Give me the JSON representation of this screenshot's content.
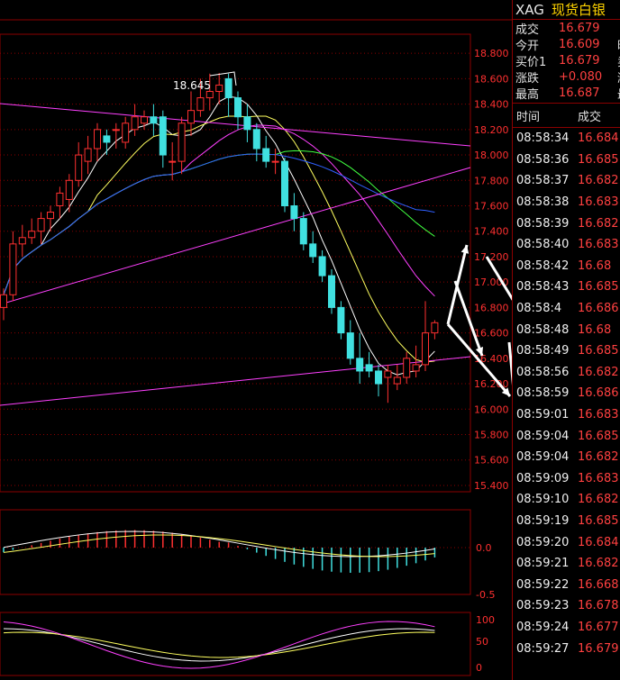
{
  "symbol": "XAG",
  "name": "现货白银",
  "quote": [
    {
      "label": "成交",
      "value": "16.679",
      "extra": ""
    },
    {
      "label": "今开",
      "value": "16.609",
      "extra": "昨"
    },
    {
      "label": "买价1",
      "value": "16.679",
      "extra": "卖"
    },
    {
      "label": "涨跌",
      "value": "+0.080",
      "extra": "涨"
    },
    {
      "label": "最高",
      "value": "16.687",
      "extra": "最"
    }
  ],
  "ticks_header": {
    "time": "时间",
    "price": "成交"
  },
  "ticks": [
    {
      "time": "08:58:34",
      "price": "16.684"
    },
    {
      "time": "08:58:36",
      "price": "16.685"
    },
    {
      "time": "08:58:37",
      "price": "16.682"
    },
    {
      "time": "08:58:38",
      "price": "16.683"
    },
    {
      "time": "08:58:39",
      "price": "16.682"
    },
    {
      "time": "08:58:40",
      "price": "16.683"
    },
    {
      "time": "08:58:42",
      "price": "16.68"
    },
    {
      "time": "08:58:43",
      "price": "16.685"
    },
    {
      "time": "08:58:4",
      "price": "16.686"
    },
    {
      "time": "08:58:48",
      "price": "16.68"
    },
    {
      "time": "08:58:49",
      "price": "16.685"
    },
    {
      "time": "08:58:56",
      "price": "16.682"
    },
    {
      "time": "08:58:59",
      "price": "16.686"
    },
    {
      "time": "08:59:01",
      "price": "16.683"
    },
    {
      "time": "08:59:04",
      "price": "16.685"
    },
    {
      "time": "08:59:04",
      "price": "16.682"
    },
    {
      "time": "08:59:09",
      "price": "16.683"
    },
    {
      "time": "08:59:10",
      "price": "16.682"
    },
    {
      "time": "08:59:19",
      "price": "16.685"
    },
    {
      "time": "08:59:20",
      "price": "16.684"
    },
    {
      "time": "08:59:21",
      "price": "16.682"
    },
    {
      "time": "08:59:22",
      "price": "16.668"
    },
    {
      "time": "08:59:23",
      "price": "16.678"
    },
    {
      "time": "08:59:24",
      "price": "16.677"
    },
    {
      "time": "08:59:27",
      "price": "16.679"
    }
  ],
  "chart_data": {
    "type": "candlestick",
    "price_axis": {
      "labels": [
        "18.800",
        "18.600",
        "18.400",
        "18.200",
        "18.000",
        "17.800",
        "17.600",
        "17.400",
        "17.200",
        "17.000",
        "16.800",
        "16.600",
        "16.400",
        "16.200",
        "16.000",
        "15.800",
        "15.600",
        "15.400"
      ],
      "range": [
        15.35,
        18.95
      ]
    },
    "high_annotation": "18.645",
    "candles": [
      [
        16.8,
        16.9,
        16.7,
        16.95
      ],
      [
        16.9,
        17.3,
        16.85,
        17.4
      ],
      [
        17.3,
        17.35,
        17.2,
        17.45
      ],
      [
        17.35,
        17.4,
        17.3,
        17.5
      ],
      [
        17.4,
        17.5,
        17.3,
        17.55
      ],
      [
        17.5,
        17.55,
        17.4,
        17.6
      ],
      [
        17.6,
        17.7,
        17.5,
        17.75
      ],
      [
        17.65,
        17.8,
        17.55,
        17.85
      ],
      [
        17.8,
        18.0,
        17.75,
        18.1
      ],
      [
        17.95,
        18.05,
        17.85,
        18.15
      ],
      [
        18.05,
        18.2,
        17.95,
        18.25
      ],
      [
        18.15,
        18.1,
        18.0,
        18.2
      ],
      [
        18.2,
        18.2,
        18.05,
        18.25
      ],
      [
        18.1,
        18.25,
        18.05,
        18.3
      ],
      [
        18.2,
        18.3,
        18.15,
        18.4
      ],
      [
        18.25,
        18.3,
        18.2,
        18.35
      ],
      [
        18.3,
        18.25,
        18.15,
        18.4
      ],
      [
        18.3,
        18.0,
        17.9,
        18.35
      ],
      [
        17.95,
        17.95,
        17.8,
        18.1
      ],
      [
        17.95,
        18.25,
        17.85,
        18.3
      ],
      [
        18.25,
        18.35,
        18.15,
        18.5
      ],
      [
        18.35,
        18.45,
        18.3,
        18.6
      ],
      [
        18.45,
        18.5,
        18.35,
        18.64
      ],
      [
        18.5,
        18.55,
        18.4,
        18.645
      ],
      [
        18.6,
        18.45,
        18.3,
        18.64
      ],
      [
        18.45,
        18.3,
        18.2,
        18.5
      ],
      [
        18.3,
        18.2,
        18.1,
        18.4
      ],
      [
        18.2,
        18.05,
        17.95,
        18.25
      ],
      [
        18.05,
        17.95,
        17.9,
        18.15
      ],
      [
        17.95,
        17.95,
        17.85,
        18.05
      ],
      [
        17.95,
        17.6,
        17.55,
        17.98
      ],
      [
        17.6,
        17.5,
        17.4,
        17.7
      ],
      [
        17.5,
        17.3,
        17.25,
        17.55
      ],
      [
        17.3,
        17.2,
        17.15,
        17.4
      ],
      [
        17.2,
        17.05,
        17.0,
        17.25
      ],
      [
        17.05,
        16.8,
        16.75,
        17.1
      ],
      [
        16.8,
        16.6,
        16.55,
        16.85
      ],
      [
        16.6,
        16.4,
        16.35,
        16.7
      ],
      [
        16.4,
        16.3,
        16.2,
        16.6
      ],
      [
        16.35,
        16.3,
        16.25,
        16.45
      ],
      [
        16.3,
        16.2,
        16.1,
        16.35
      ],
      [
        16.25,
        16.3,
        16.05,
        16.35
      ],
      [
        16.2,
        16.25,
        16.15,
        16.35
      ],
      [
        16.25,
        16.4,
        16.2,
        16.45
      ],
      [
        16.3,
        16.35,
        16.25,
        16.5
      ],
      [
        16.35,
        16.6,
        16.3,
        16.85
      ],
      [
        16.6,
        16.68,
        16.55,
        16.7
      ]
    ],
    "macd_axis": {
      "labels": [
        "0.0",
        "-0.5"
      ]
    },
    "kdj_axis": {
      "labels": [
        "100",
        "50",
        "0"
      ]
    },
    "colors": {
      "up": "#ff3030",
      "down": "#40e0e0",
      "grid": "#8b0000",
      "axis": "#ff3030",
      "ma5": "#ffffff",
      "ma10": "#ffff60",
      "ma20": "#ff40ff",
      "ma30": "#40ff40",
      "ma60": "#3060ff",
      "ma120": "#a0a0a0",
      "trend": "#ff40ff"
    }
  }
}
